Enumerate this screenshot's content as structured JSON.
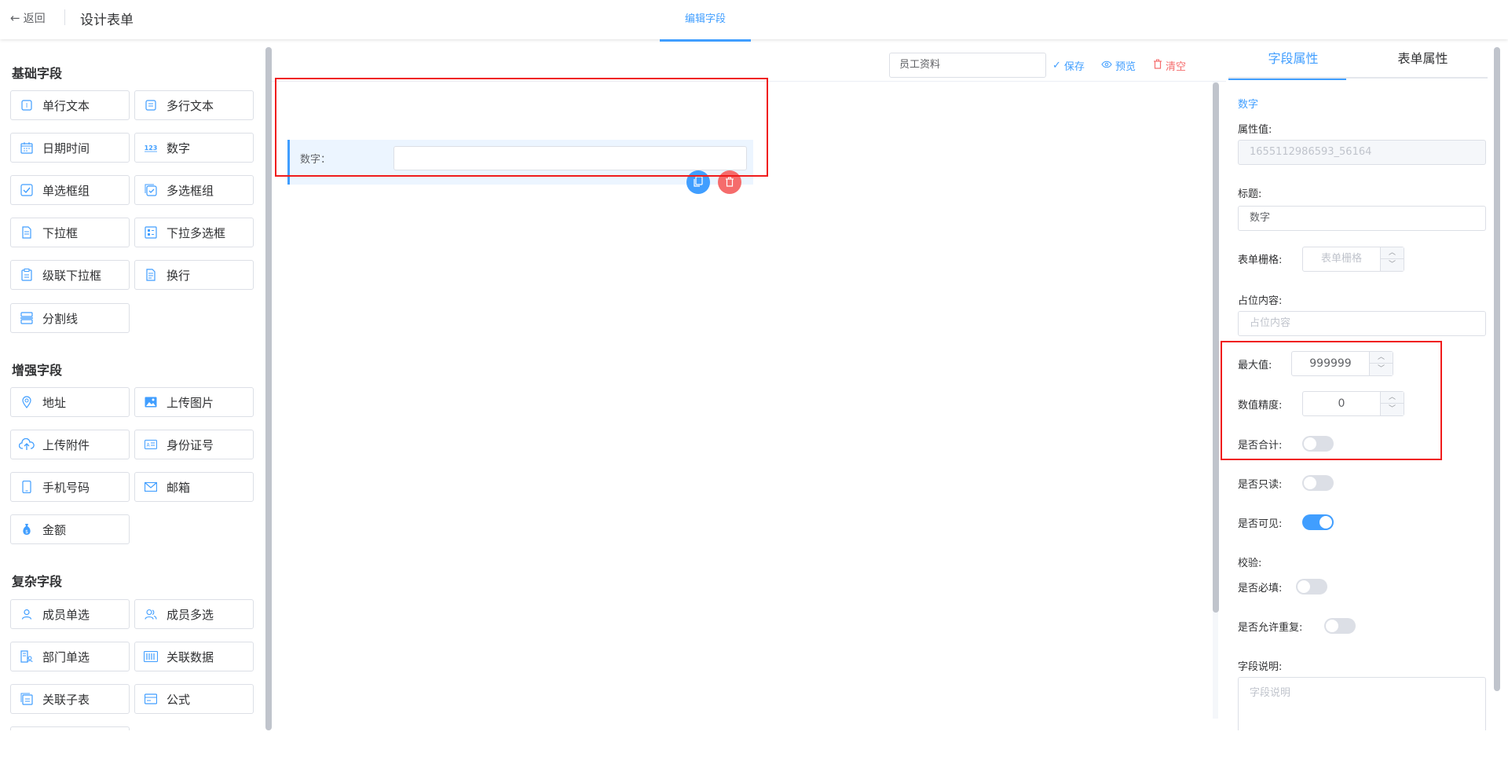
{
  "header": {
    "back_label": "返回",
    "title": "设计表单",
    "active_tab": "编辑字段"
  },
  "left_panel": {
    "groups": [
      {
        "title": "基础字段",
        "items": [
          {
            "label": "单行文本",
            "icon": "single-line-text-icon"
          },
          {
            "label": "多行文本",
            "icon": "multi-line-text-icon"
          },
          {
            "label": "日期时间",
            "icon": "calendar-icon"
          },
          {
            "label": "数字",
            "icon": "number-123-icon"
          },
          {
            "label": "单选框组",
            "icon": "radio-group-icon"
          },
          {
            "label": "多选框组",
            "icon": "checkbox-group-icon"
          },
          {
            "label": "下拉框",
            "icon": "select-icon"
          },
          {
            "label": "下拉多选框",
            "icon": "multi-select-icon"
          },
          {
            "label": "级联下拉框",
            "icon": "cascader-icon"
          },
          {
            "label": "换行",
            "icon": "line-break-icon"
          },
          {
            "label": "分割线",
            "icon": "divider-icon"
          }
        ]
      },
      {
        "title": "增强字段",
        "items": [
          {
            "label": "地址",
            "icon": "location-icon"
          },
          {
            "label": "上传图片",
            "icon": "image-icon"
          },
          {
            "label": "上传附件",
            "icon": "cloud-upload-icon"
          },
          {
            "label": "身份证号",
            "icon": "id-card-icon"
          },
          {
            "label": "手机号码",
            "icon": "phone-icon"
          },
          {
            "label": "邮箱",
            "icon": "mail-icon"
          },
          {
            "label": "金额",
            "icon": "money-bag-icon"
          }
        ]
      },
      {
        "title": "复杂字段",
        "items": [
          {
            "label": "成员单选",
            "icon": "user-icon"
          },
          {
            "label": "成员多选",
            "icon": "users-icon"
          },
          {
            "label": "部门单选",
            "icon": "department-icon"
          },
          {
            "label": "关联数据",
            "icon": "link-data-icon"
          },
          {
            "label": "关联子表",
            "icon": "sub-table-icon"
          },
          {
            "label": "公式",
            "icon": "formula-icon"
          }
        ]
      }
    ]
  },
  "toolbar": {
    "form_name": "员工资料",
    "save_label": "保存",
    "preview_label": "预览",
    "clear_label": "清空"
  },
  "canvas": {
    "field_label": "数字："
  },
  "right_panel": {
    "tabs": [
      "字段属性",
      "表单属性"
    ],
    "field_type": "数字",
    "prop_value_label": "属性值:",
    "prop_value": "1655112986593_56164",
    "title_label": "标题:",
    "title_value": "数字",
    "grid_label": "表单栅格:",
    "grid_placeholder": "表单栅格",
    "placeholder_label": "占位内容:",
    "placeholder_placeholder": "占位内容",
    "max_label": "最大值:",
    "max_value": "999999",
    "precision_label": "数值精度:",
    "precision_value": "0",
    "sum_label": "是否合计:",
    "readonly_label": "是否只读:",
    "visible_label": "是否可见:",
    "validate_label": "校验:",
    "required_label": "是否必填:",
    "duplicate_label": "是否允许重复:",
    "desc_label": "字段说明:",
    "desc_placeholder": "字段说明",
    "switches": {
      "sum": false,
      "readonly": false,
      "visible": true,
      "required": false,
      "duplicate": false
    },
    "accent_color": "#409eff"
  }
}
